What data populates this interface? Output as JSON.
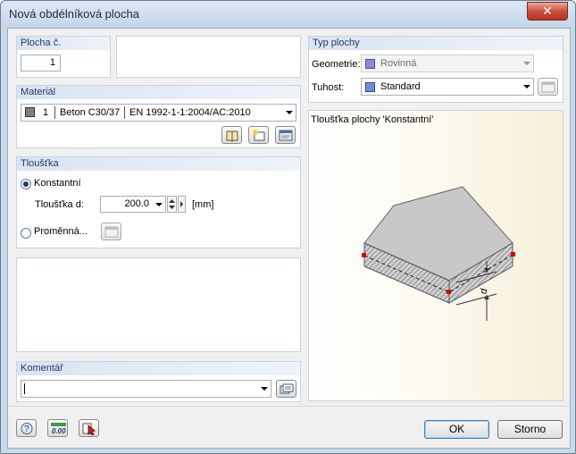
{
  "window": {
    "title": "Nová obdélníková plocha",
    "close_glyph": "✕"
  },
  "surface_no": {
    "label": "Plocha č.",
    "value": "1"
  },
  "material": {
    "label": "Materiál",
    "number": "1",
    "name": "Beton C30/37",
    "standard": "EN 1992-1-1:2004/AC:2010",
    "swatch_color": "#808080"
  },
  "thickness": {
    "label": "Tloušťka",
    "constant_label": "Konstantní",
    "d_label": "Tloušťka d:",
    "d_value": "200.0",
    "unit": "[mm]",
    "variable_label": "Proměnná..."
  },
  "comment": {
    "label": "Komentář",
    "value": ""
  },
  "surface_type": {
    "label": "Typ plochy",
    "geometry_label": "Geometrie:",
    "geometry_value": "Rovinná",
    "geometry_color": "#8b8bd6",
    "stiffness_label": "Tuhost:",
    "stiffness_value": "Standard",
    "stiffness_color": "#6b8fdb"
  },
  "preview": {
    "caption": "Tloušťka plochy 'Konstantní'",
    "dim_label": "d"
  },
  "footer": {
    "ok_label": "OK",
    "cancel_label": "Storno",
    "units_icon_text": "0.00"
  }
}
